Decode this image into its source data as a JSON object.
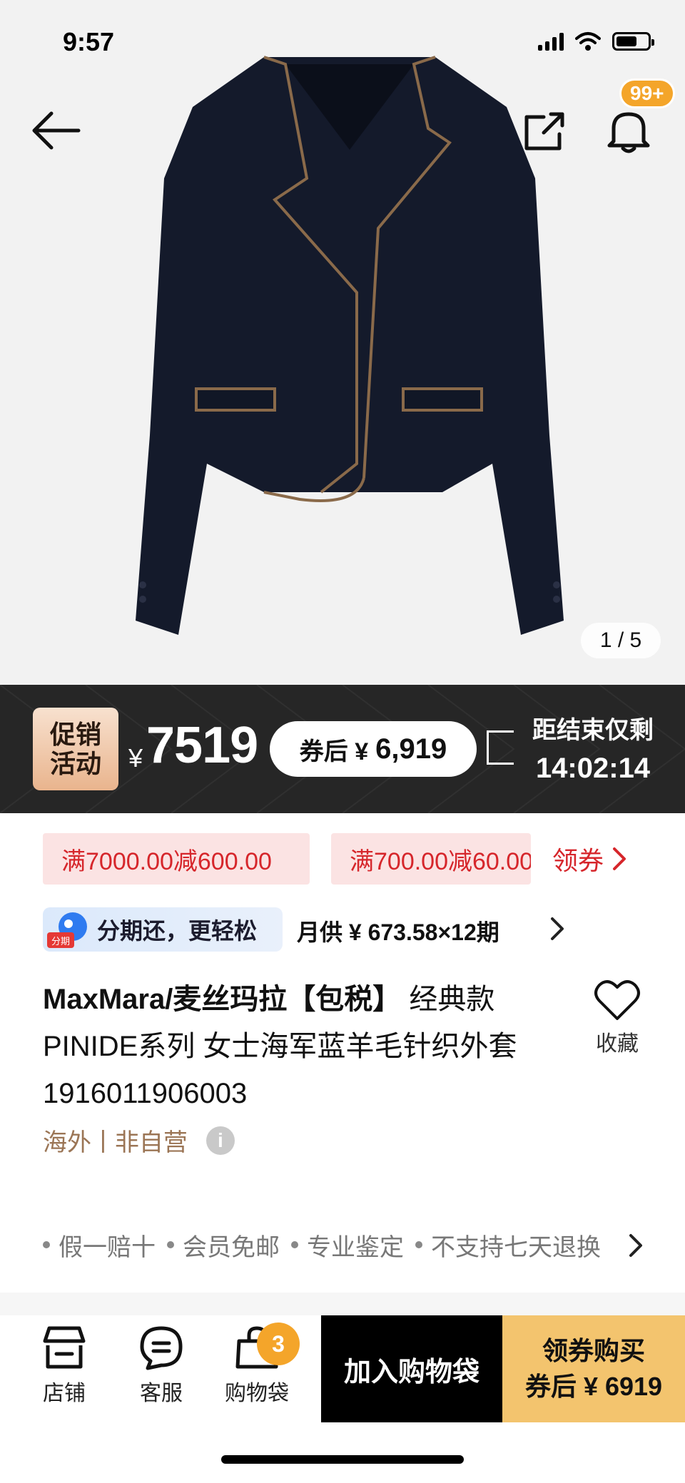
{
  "status_bar": {
    "time": "9:57"
  },
  "header": {
    "notifications_badge": "99+"
  },
  "gallery": {
    "pager": "1 / 5"
  },
  "promo": {
    "badge_line1": "促销",
    "badge_line2": "活动",
    "currency": "¥",
    "price": "7519",
    "after_coupon_label": "券后 ¥",
    "after_coupon_price": "6,919",
    "countdown_label": "距结束仅剩",
    "countdown_time": "14:02:14"
  },
  "coupons": {
    "items": [
      "满7000.00减600.00",
      "满700.00减60.00"
    ],
    "get_label": "领券"
  },
  "installment": {
    "badge_small": "分期",
    "badge_text": "分期还，更轻松",
    "monthly": "月供 ¥ 673.58×12期"
  },
  "product": {
    "brand": "MaxMara/麦丝玛拉【包税】",
    "title_rest": " 经典款 PINIDE系列 女士海军蓝羊毛针织外套1916011906003",
    "tag_origin": "海外",
    "tag_separator": "|",
    "tag_seller": "非自营",
    "info_icon_glyph": "i",
    "favorite_label": "收藏"
  },
  "guarantees": [
    "假一赔十",
    "会员免邮",
    "专业鉴定",
    "不支持七天退换"
  ],
  "bottom_bar": {
    "store_label": "店铺",
    "service_label": "客服",
    "bag_label": "购物袋",
    "bag_count": "3",
    "add_to_cart": "加入购物袋",
    "buy_line1": "领券购买",
    "buy_line2": "券后 ¥ 6919"
  },
  "colors": {
    "accent_red": "#d6262b",
    "badge_orange": "#f4a52a",
    "buy_gold": "#f3c46e",
    "promo_dark": "#262626",
    "tag_brown": "#9b7555"
  }
}
